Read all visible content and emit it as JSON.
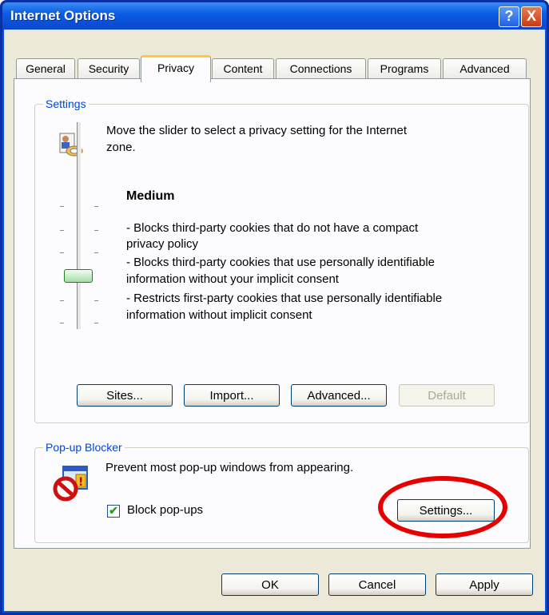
{
  "window": {
    "title": "Internet Options",
    "help_label": "?",
    "close_label": "X"
  },
  "tabs": [
    {
      "label": "General"
    },
    {
      "label": "Security"
    },
    {
      "label": "Privacy"
    },
    {
      "label": "Content"
    },
    {
      "label": "Connections"
    },
    {
      "label": "Programs"
    },
    {
      "label": "Advanced"
    }
  ],
  "active_tab": "Privacy",
  "settings_group": {
    "label": "Settings",
    "intro_line1": "Move the slider to select a privacy setting for the Internet",
    "intro_line2": "zone.",
    "level_title": "Medium",
    "desc_lines": [
      "- Blocks third-party cookies that do not have a compact",
      "privacy policy",
      "- Blocks third-party cookies that use personally identifiable",
      "information without your implicit consent",
      "- Restricts first-party cookies that use personally identifiable",
      "information without implicit consent"
    ],
    "buttons": {
      "sites": "Sites...",
      "import": "Import...",
      "advanced": "Advanced...",
      "default": "Default"
    }
  },
  "popup_group": {
    "label": "Pop-up Blocker",
    "description": "Prevent most pop-up windows from appearing.",
    "checkbox_label": "Block pop-ups",
    "checkbox_checked": true,
    "settings_button": "Settings..."
  },
  "footer": {
    "ok": "OK",
    "cancel": "Cancel",
    "apply": "Apply"
  },
  "highlight_color": "#e60000"
}
